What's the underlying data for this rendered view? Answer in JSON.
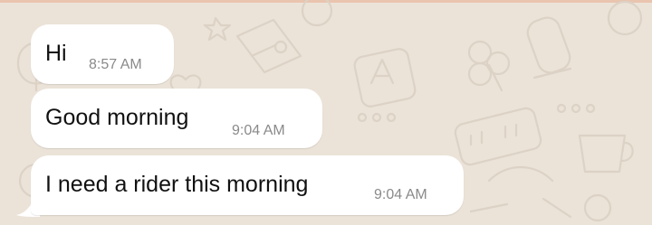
{
  "chat": {
    "messages": [
      {
        "text": "Hi",
        "time": "8:57 AM"
      },
      {
        "text": "Good morning",
        "time": "9:04 AM"
      },
      {
        "text": "I need a rider this morning",
        "time": "9:04 AM"
      }
    ]
  },
  "colors": {
    "background": "#ebe3d8",
    "bubble": "#ffffff",
    "text": "#111111",
    "timestamp": "#8a8a8a"
  },
  "icons": {
    "wallpaper": [
      "clock-doodle",
      "clover-doodle",
      "translate-doodle",
      "book-doodle",
      "cup-doodle",
      "star-doodle",
      "heart-doodle",
      "mic-doodle"
    ]
  }
}
